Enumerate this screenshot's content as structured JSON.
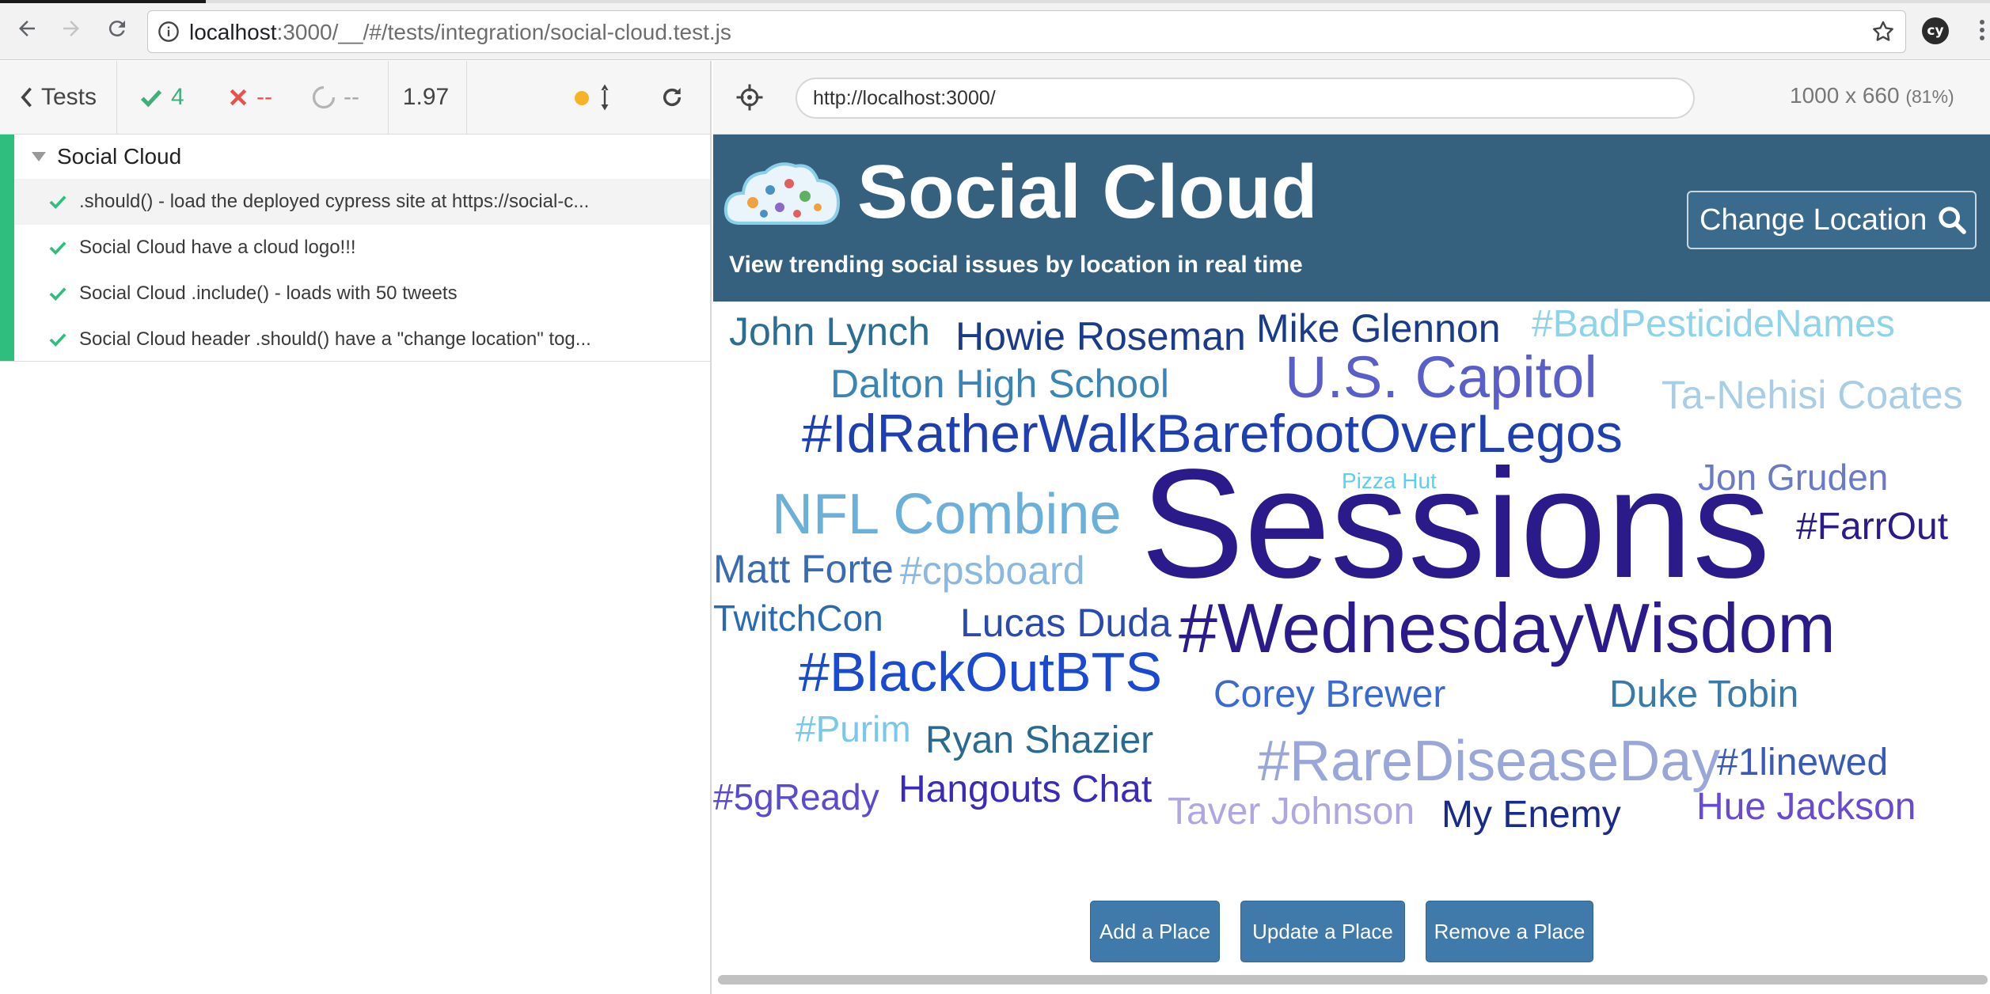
{
  "browser": {
    "url_host": "localhost",
    "url_rest": ":3000/__/#/tests/integration/social-cloud.test.js",
    "extension_label": "cy"
  },
  "reporter": {
    "back_label": "Tests",
    "passed": "4",
    "failed": "--",
    "pending": "--",
    "duration": "1.97",
    "suite_title": "Social Cloud",
    "tests": [
      ".should() - load the deployed cypress site at https://social-c...",
      "Social Cloud have a cloud logo!!!",
      "Social Cloud .include() - loads with 50 tweets",
      "Social Cloud header .should() have a \"change location\" tog..."
    ]
  },
  "aut": {
    "url": "http://localhost:3000/",
    "viewport": "1000 x 660",
    "zoom": "(81%)"
  },
  "app": {
    "title": "Social Cloud",
    "subtitle": "View trending social issues by location in real time",
    "change_location": "Change Location",
    "words": [
      {
        "text": "John Lynch",
        "color": "#2b6e94"
      },
      {
        "text": "Howie Roseman",
        "color": "#1a3a8a"
      },
      {
        "text": "Mike Glennon",
        "color": "#1a3a8a"
      },
      {
        "text": "#BadPesticideNames",
        "color": "#8fd3e8"
      },
      {
        "text": "Dalton High School",
        "color": "#3a85b5"
      },
      {
        "text": "U.S. Capitol",
        "color": "#5a5ec8"
      },
      {
        "text": "Ta-Nehisi Coates",
        "color": "#a9cde4"
      },
      {
        "text": "#IdRatherWalkBarefootOverLegos",
        "color": "#1f3fb0"
      },
      {
        "text": "Sessions",
        "color": "#2a1a8a"
      },
      {
        "text": "Pizza Hut",
        "color": "#5ad0f0"
      },
      {
        "text": "Jon Gruden",
        "color": "#6a7ac8"
      },
      {
        "text": "NFL Combine",
        "color": "#6ab0d8"
      },
      {
        "text": "#FarrOut",
        "color": "#2a1a8a"
      },
      {
        "text": "Matt Forte",
        "color": "#3a6ab0"
      },
      {
        "text": "#cpsboard",
        "color": "#8ab8e0"
      },
      {
        "text": "TwitchCon",
        "color": "#2a6ab0"
      },
      {
        "text": "Lucas Duda",
        "color": "#2a4ab0"
      },
      {
        "text": "#WednesdayWisdom",
        "color": "#2a1a8a"
      },
      {
        "text": "#BlackOutBTS",
        "color": "#1a4ad0"
      },
      {
        "text": "Corey Brewer",
        "color": "#3a6ad0"
      },
      {
        "text": "Duke Tobin",
        "color": "#3a7aa8"
      },
      {
        "text": "#Purim",
        "color": "#7ac8e8"
      },
      {
        "text": "Ryan Shazier",
        "color": "#2a6a90"
      },
      {
        "text": "#RareDiseaseDay",
        "color": "#9aa6d8"
      },
      {
        "text": "#1linewed",
        "color": "#3a5ab8"
      },
      {
        "text": "#5gReady",
        "color": "#5a4ad0"
      },
      {
        "text": "Hangouts Chat",
        "color": "#3a2ab8"
      },
      {
        "text": "Taver Johnson",
        "color": "#b0a6e0"
      },
      {
        "text": "My Enemy",
        "color": "#1a2a8a"
      },
      {
        "text": "Hue Jackson",
        "color": "#6a4ad0"
      }
    ],
    "buttons": {
      "add": "Add a Place",
      "update": "Update a Place",
      "remove": "Remove a Place"
    }
  },
  "colors": {
    "header_bg": "#35617f",
    "pass_green": "#2ebf7e",
    "fail_red": "#e94f4f",
    "button_blue": "#3f7aab"
  }
}
